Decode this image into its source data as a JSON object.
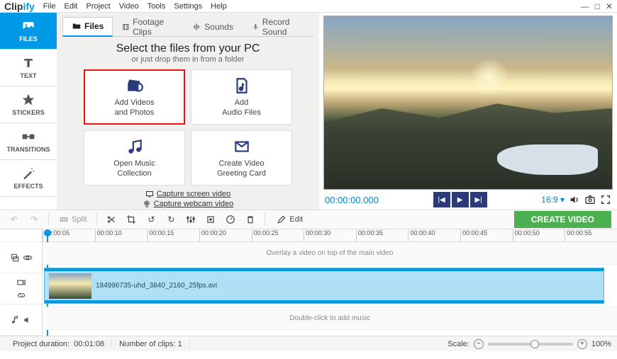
{
  "app": {
    "name_a": "Clip",
    "name_b": "ify"
  },
  "menu": [
    "File",
    "Edit",
    "Project",
    "Video",
    "Tools",
    "Settings",
    "Help"
  ],
  "sidebar": [
    {
      "label": "FILES"
    },
    {
      "label": "TEXT"
    },
    {
      "label": "STICKERS"
    },
    {
      "label": "TRANSITIONS"
    },
    {
      "label": "EFFECTS"
    }
  ],
  "tabs": [
    {
      "label": "Files"
    },
    {
      "label": "Footage Clips"
    },
    {
      "label": "Sounds"
    },
    {
      "label": "Record Sound"
    }
  ],
  "panel": {
    "heading": "Select the files from your PC",
    "sub": "or just drop them in from a folder",
    "cards": [
      {
        "l1": "Add Videos",
        "l2": "and Photos"
      },
      {
        "l1": "Add",
        "l2": "Audio Files"
      },
      {
        "l1": "Open Music",
        "l2": "Collection"
      },
      {
        "l1": "Create Video",
        "l2": "Greeting Card"
      }
    ],
    "cap_screen": "Capture screen video",
    "cap_webcam": "Capture webcam video"
  },
  "preview": {
    "timecode": "00:00:00.000",
    "aspect": "16:9"
  },
  "toolbar": {
    "split": "Split",
    "edit": "Edit",
    "create": "CREATE VIDEO"
  },
  "ruler": [
    "00:00:05",
    "00:00:10",
    "00:00:15",
    "00:00:20",
    "00:00:25",
    "00:00:30",
    "00:00:35",
    "00:00:40",
    "00:00:45",
    "00:00:50",
    "00:00:55"
  ],
  "tracks": {
    "overlay_hint": "Overlay a video on top of the main video",
    "clip_name": "184996735-uhd_3840_2160_25fps.avi",
    "music_hint": "Double-click to add music"
  },
  "status": {
    "duration_label": "Project duration:",
    "duration_val": "00:01:08",
    "clips_label": "Number of clips:",
    "clips_val": "1",
    "scale_label": "Scale:",
    "scale_val": "100%"
  }
}
